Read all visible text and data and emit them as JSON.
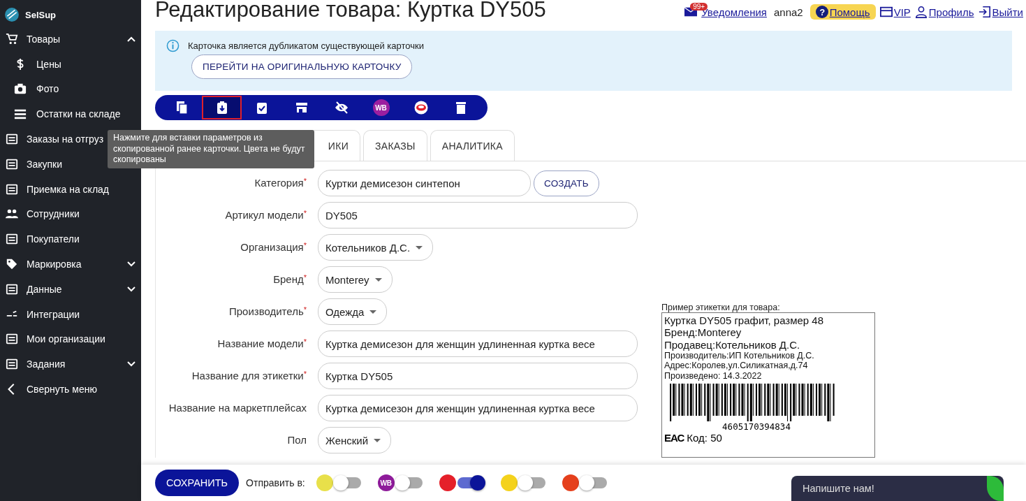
{
  "sidebar": {
    "brand": "SelSup",
    "items": [
      {
        "label": "Товары",
        "expanded": true,
        "children": [
          {
            "label": "Цены"
          },
          {
            "label": "Фото"
          },
          {
            "label": "Остатки на складе"
          }
        ]
      },
      {
        "label": "Заказы на отгруз"
      },
      {
        "label": "Закупки"
      },
      {
        "label": "Приемка на склад"
      },
      {
        "label": "Сотрудники"
      },
      {
        "label": "Покупатели"
      },
      {
        "label": "Маркировка",
        "expanded": false
      },
      {
        "label": "Данные",
        "expanded": false
      },
      {
        "label": "Интеграции"
      },
      {
        "label": "Мои организации"
      },
      {
        "label": "Задания",
        "expanded": false
      },
      {
        "label": "Свернуть меню"
      }
    ]
  },
  "header": {
    "title": "Редактирование товара: Куртка DY505",
    "badge": "99+",
    "links": [
      {
        "label": "Уведомления",
        "kind": "notifications"
      },
      {
        "label": "anna2",
        "kind": "user"
      },
      {
        "label": "Помощь",
        "kind": "help",
        "glyph": "?"
      },
      {
        "label": "VIP",
        "kind": "vip"
      },
      {
        "label": "Профиль",
        "kind": "profile"
      },
      {
        "label": "Выйти",
        "kind": "logout"
      }
    ]
  },
  "notice": {
    "text": "Карточка является дубликатом существующей карточки",
    "button": "ПЕРЕЙТИ НА ОРИГИНАЛЬНУЮ КАРТОЧКУ"
  },
  "toolbar": {
    "buttons": [
      {
        "selected": false
      },
      {
        "selected": true
      },
      {
        "selected": false
      },
      {
        "selected": false
      },
      {
        "selected": false
      },
      {
        "selected": false
      },
      {
        "selected": false
      },
      {
        "selected": false
      }
    ],
    "wb_label": "WB",
    "tooltip": "Нажмите для вставки параметров из скопированной ранее карточки. Цвета не будут скопированы"
  },
  "tabs": [
    {
      "label": "ИКИ",
      "selected": false
    },
    {
      "label": "ЗАКАЗЫ",
      "selected": false
    },
    {
      "label": "АНАЛИТИКА",
      "selected": false
    }
  ],
  "form": {
    "fields": [
      {
        "label": "Категория",
        "marker": "*",
        "kind": "text",
        "value": "Куртки демисезон синтепон",
        "action": "СОЗДАТЬ"
      },
      {
        "label": "Артикул модели",
        "marker": "*",
        "kind": "wide",
        "value": "DY505"
      },
      {
        "label": "Организация",
        "marker": "*",
        "kind": "select",
        "value": "Котельников Д.С."
      },
      {
        "label": "Бренд",
        "marker": "*",
        "kind": "select",
        "value": "Monterey"
      },
      {
        "label": "Производитель",
        "marker": "*",
        "kind": "select",
        "value": "Одежда"
      },
      {
        "label": "Название модели",
        "marker": "*",
        "kind": "wide",
        "value": "Куртка демисезон для женщин удлиненная куртка весе"
      },
      {
        "label": "Название для этикетки",
        "marker": "*",
        "kind": "wide",
        "value": "Куртка DY505"
      },
      {
        "label": "Название на маркетплейсах",
        "kind": "wide",
        "value": "Куртка демисезон для женщин удлиненная куртка весе"
      },
      {
        "label": "Пол",
        "kind": "select",
        "value": "Женский"
      }
    ]
  },
  "label_preview": {
    "caption": "Пример этикетки для товара:",
    "lines": [
      {
        "text": "Куртка DY505 графит, размер 48"
      },
      {
        "text": "Бренд:Monterey"
      },
      {
        "text": "Продавец:Котельников Д.С."
      },
      {
        "text": "Производитель:ИП Котельников Д.С."
      },
      {
        "text": "Адрес:Королев,ул.Силикатная,д.74"
      },
      {
        "text": "Произведено: 14.3.2022"
      }
    ],
    "barcode": "4605170394834",
    "eac": "ЕАС",
    "code": "Код: 50"
  },
  "bottom_bar": {
    "save": "СОХРАНИТЬ",
    "send_to": "Отправить в:",
    "wb_label": "WB",
    "targets": [
      {
        "on": false,
        "color": "#e8e04a"
      },
      {
        "on": false,
        "color": "#8e1b9a"
      },
      {
        "on": true,
        "color": "#e5202a"
      },
      {
        "on": false,
        "color": "#f4d21c"
      },
      {
        "on": false,
        "color": "#e5401c"
      }
    ]
  },
  "chat": {
    "text": "Напишите нам!"
  }
}
